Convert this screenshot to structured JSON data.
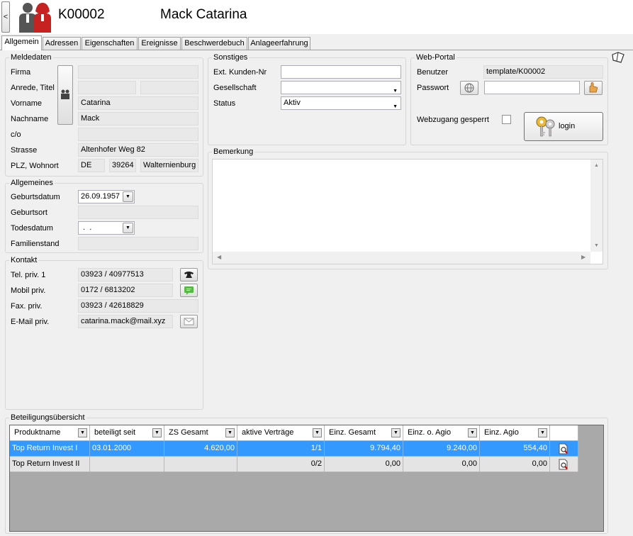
{
  "header": {
    "back_label": "<",
    "customer_id": "K00002",
    "customer_name": "Mack Catarina"
  },
  "tabs": [
    "Allgemein",
    "Adressen",
    "Eigenschaften",
    "Ereignisse",
    "Beschwerdebuch",
    "Anlageerfahrung"
  ],
  "meldedaten": {
    "title": "Meldedaten",
    "firma_label": "Firma",
    "firma": "",
    "anrede_label": "Anrede, Titel",
    "anrede": "",
    "titel": "",
    "vorname_label": "Vorname",
    "vorname": "Catarina",
    "nachname_label": "Nachname",
    "nachname": "Mack",
    "co_label": "c/o",
    "co": "",
    "strasse_label": "Strasse",
    "strasse": "Altenhofer Weg 82",
    "plz_label": "PLZ, Wohnort",
    "land": "DE",
    "plz": "39264",
    "ort": "Walternienburg"
  },
  "allgemeines": {
    "title": "Allgemeines",
    "geburtsdatum_label": "Geburtsdatum",
    "geburtsdatum": "26.09.1957",
    "geburtsort_label": "Geburtsort",
    "geburtsort": "",
    "todesdatum_label": "Todesdatum",
    "todesdatum": " .  .",
    "familienstand_label": "Familienstand",
    "familienstand": ""
  },
  "kontakt": {
    "title": "Kontakt",
    "tel_label": "Tel. priv. 1",
    "tel": "03923 / 40977513",
    "mobil_label": "Mobil priv.",
    "mobil": "0172 / 6813202",
    "fax_label": "Fax. priv.",
    "fax": "03923 / 42618829",
    "email_label": "E-Mail priv.",
    "email": "catarina.mack@mail.xyz"
  },
  "sonstiges": {
    "title": "Sonstiges",
    "ext_label": "Ext. Kunden-Nr",
    "ext": "",
    "gesellschaft_label": "Gesellschaft",
    "gesellschaft": "",
    "status_label": "Status",
    "status": "Aktiv"
  },
  "webportal": {
    "title": "Web-Portal",
    "benutzer_label": "Benutzer",
    "benutzer": "template/K00002",
    "passwort_label": "Passwort",
    "passwort": "",
    "gesperrt_label": "Webzugang gesperrt",
    "login_label": "login"
  },
  "bemerkung": {
    "title": "Bemerkung",
    "text": ""
  },
  "beteiligung": {
    "title": "Beteiligungsübersicht",
    "columns": [
      "Produktname",
      "beteiligt seit",
      "ZS Gesamt",
      "aktive Verträge",
      "Einz. Gesamt",
      "Einz. o. Agio",
      "Einz. Agio"
    ],
    "rows": [
      [
        "Top Return Invest I",
        "03.01.2000",
        "4.620,00",
        "1/1",
        "9.794,40",
        "9.240,00",
        "554,40"
      ],
      [
        "Top Return Invest II",
        "",
        "",
        "0/2",
        "0,00",
        "0,00",
        "0,00"
      ]
    ]
  },
  "colors": {
    "selection": "#3399ff",
    "grid_bg": "#a9a9a9",
    "window_bg": "#f0f0f0"
  }
}
